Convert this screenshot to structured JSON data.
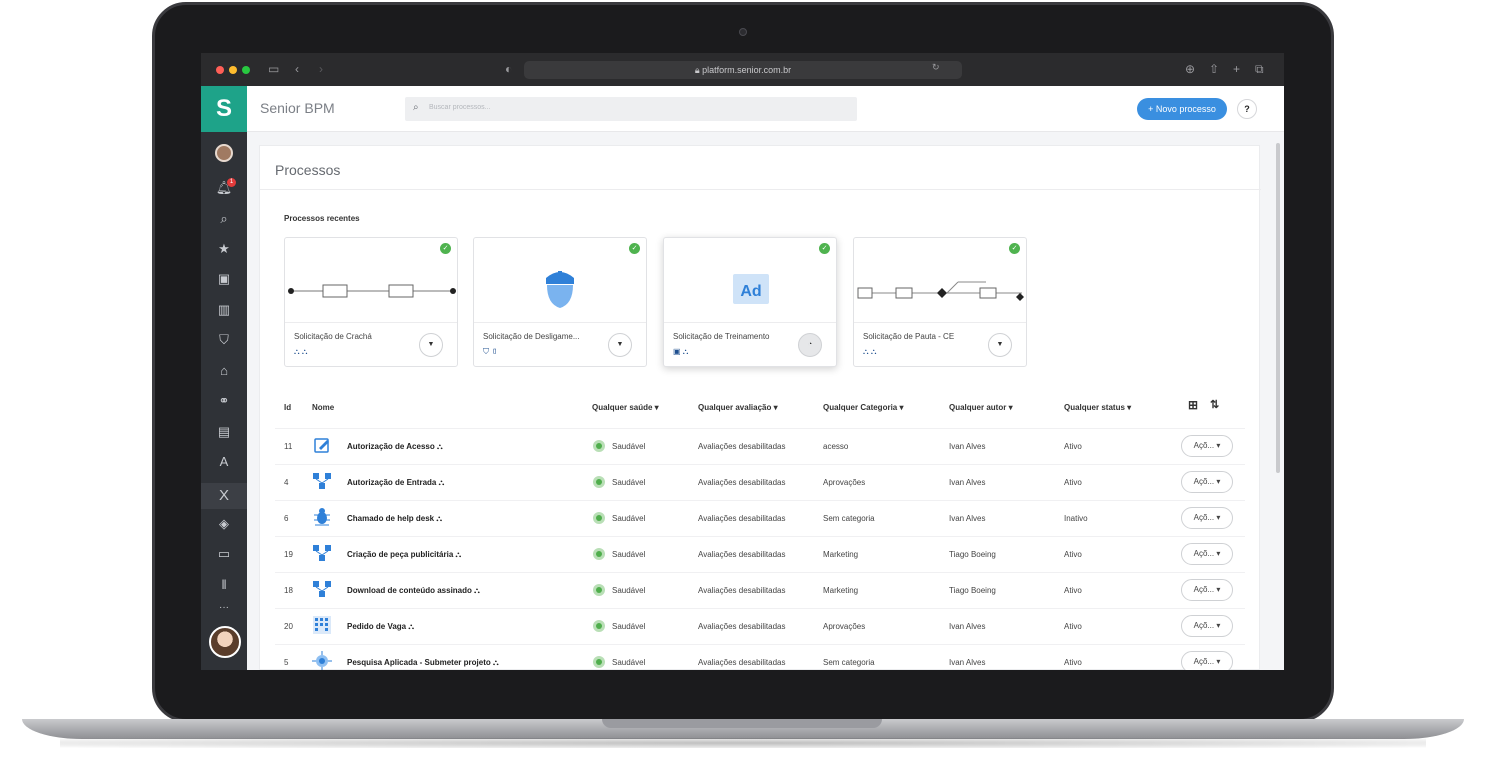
{
  "browser": {
    "url": "platform.senior.com.br",
    "traffic_colors": [
      "#ff5f57",
      "#febc2e",
      "#28c840"
    ]
  },
  "app": {
    "brand_color": "#1ea389",
    "title": "Senior BPM",
    "search_placeholder": "Buscar processos...",
    "new_process_label": "+ Novo processo",
    "help_label": "?",
    "notification_count": "1",
    "sidebar_icons": [
      "user-avatar",
      "bell-icon",
      "search-icon",
      "star-icon",
      "cube-icon",
      "chart-icon",
      "shield-icon",
      "org-icon",
      "handshake-icon",
      "briefcase-icon",
      "font-icon",
      "x-icon",
      "diamond-icon",
      "monitor-icon",
      "pause-icon",
      "more-icon",
      "profile-avatar"
    ],
    "more_label": "···"
  },
  "page": {
    "title": "Processos",
    "recent_label": "Processos recentes"
  },
  "recent_cards": [
    {
      "name": "Solicitação de Crachá",
      "thumb": "flow-diagram",
      "selected": false
    },
    {
      "name": "Solicitação de Desligame...",
      "thumb": "acorn-icon",
      "selected": false
    },
    {
      "name": "Solicitação de Treinamento",
      "thumb": "ad-icon",
      "thumb_text": "Ad",
      "selected": true
    },
    {
      "name": "Solicitação de Pauta - CE",
      "thumb": "flow-diagram",
      "selected": false
    }
  ],
  "table": {
    "headers": {
      "id": "Id",
      "nome": "Nome",
      "saude": "Qualquer saúde ▾",
      "avaliacao": "Qualquer avaliação ▾",
      "categoria": "Qualquer Categoria ▾",
      "autor": "Qualquer autor ▾",
      "status": "Qualquer status ▾"
    },
    "rows": [
      {
        "id": "11",
        "nome": "Autorização de Acesso",
        "icon": "edit-icon",
        "saude": "Saudável",
        "avaliacao": "Avaliações desabilitadas",
        "categoria": "acesso",
        "autor": "Ivan Alves",
        "status": "Ativo",
        "acoes": "Açõ... ▾"
      },
      {
        "id": "4",
        "nome": "Autorização de Entrada",
        "icon": "network-icon",
        "saude": "Saudável",
        "avaliacao": "Avaliações desabilitadas",
        "categoria": "Aprovações",
        "autor": "Ivan Alves",
        "status": "Ativo",
        "acoes": "Açõ... ▾"
      },
      {
        "id": "6",
        "nome": "Chamado de help desk",
        "icon": "bug-icon",
        "saude": "Saudável",
        "avaliacao": "Avaliações desabilitadas",
        "categoria": "Sem categoria",
        "autor": "Ivan Alves",
        "status": "Inativo",
        "acoes": "Açõ... ▾"
      },
      {
        "id": "19",
        "nome": "Criação de peça publicitária",
        "icon": "network-icon",
        "saude": "Saudável",
        "avaliacao": "Avaliações desabilitadas",
        "categoria": "Marketing",
        "autor": "Tiago Boeing",
        "status": "Ativo",
        "acoes": "Açõ... ▾"
      },
      {
        "id": "18",
        "nome": "Download de conteúdo assinado",
        "icon": "network-icon",
        "saude": "Saudável",
        "avaliacao": "Avaliações desabilitadas",
        "categoria": "Marketing",
        "autor": "Tiago Boeing",
        "status": "Ativo",
        "acoes": "Açõ... ▾"
      },
      {
        "id": "20",
        "nome": "Pedido de Vaga",
        "icon": "grid-icon",
        "saude": "Saudável",
        "avaliacao": "Avaliações desabilitadas",
        "categoria": "Aprovações",
        "autor": "Ivan Alves",
        "status": "Ativo",
        "acoes": "Açõ... ▾"
      },
      {
        "id": "5",
        "nome": "Pesquisa Aplicada - Submeter projeto",
        "icon": "virus-icon",
        "saude": "Saudável",
        "avaliacao": "Avaliações desabilitadas",
        "categoria": "Sem categoria",
        "autor": "Ivan Alves",
        "status": "Ativo",
        "acoes": "Açõ... ▾"
      }
    ]
  }
}
